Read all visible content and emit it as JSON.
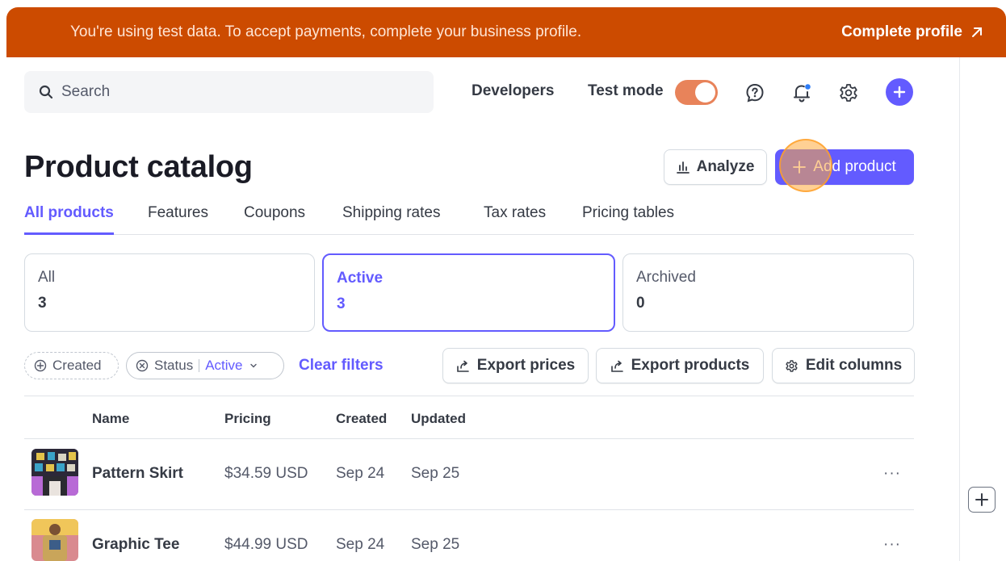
{
  "banner": {
    "message": "You're using test data. To accept payments, complete your business profile.",
    "cta_label": "Complete profile",
    "bg_color": "#cc4b00"
  },
  "topbar": {
    "search_placeholder": "Search",
    "developers_label": "Developers",
    "test_mode_label": "Test mode",
    "test_mode_on": true,
    "icons": [
      "help-icon",
      "notification-bell-icon",
      "gear-icon",
      "plus-icon"
    ]
  },
  "header": {
    "title": "Product catalog",
    "analyze_label": "Analyze",
    "add_product_label": "Add product",
    "accent_color": "#635bff"
  },
  "tabs": [
    {
      "label": "All products",
      "active": true
    },
    {
      "label": "Features",
      "active": false
    },
    {
      "label": "Coupons",
      "active": false
    },
    {
      "label": "Shipping rates",
      "active": false
    },
    {
      "label": "Tax rates",
      "active": false
    },
    {
      "label": "Pricing tables",
      "active": false
    }
  ],
  "status_cards": [
    {
      "label": "All",
      "count": "3",
      "active": false
    },
    {
      "label": "Active",
      "count": "3",
      "active": true
    },
    {
      "label": "Archived",
      "count": "0",
      "active": false
    }
  ],
  "filters": {
    "created_label": "Created",
    "status_label": "Status",
    "status_value": "Active",
    "clear_label": "Clear filters"
  },
  "actions": {
    "export_prices": "Export prices",
    "export_products": "Export products",
    "edit_columns": "Edit columns"
  },
  "table": {
    "columns": [
      "Name",
      "Pricing",
      "Created",
      "Updated"
    ],
    "rows": [
      {
        "name": "Pattern Skirt",
        "pricing": "$34.59 USD",
        "created": "Sep 24",
        "updated": "Sep 25",
        "more": "···"
      },
      {
        "name": "Graphic Tee",
        "pricing": "$44.99 USD",
        "created": "Sep 24",
        "updated": "Sep 25",
        "more": "···"
      }
    ]
  }
}
